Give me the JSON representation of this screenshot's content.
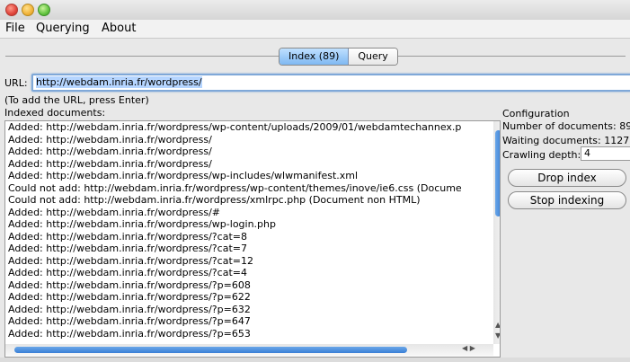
{
  "menu": [
    "File",
    "Querying",
    "About"
  ],
  "tabs": {
    "index": "Index (89)",
    "query": "Query"
  },
  "url": {
    "label": "URL:",
    "value": "http://webdam.inria.fr/wordpress/"
  },
  "hint": "(To add the URL, press Enter)",
  "indexed_label": "Indexed documents:",
  "log": [
    "Added: http://webdam.inria.fr/wordpress/wp-content/uploads/2009/01/webdamtechannex.p",
    "Added: http://webdam.inria.fr/wordpress/",
    "Added: http://webdam.inria.fr/wordpress/",
    "Added: http://webdam.inria.fr/wordpress/",
    "Added: http://webdam.inria.fr/wordpress/wp-includes/wlwmanifest.xml",
    "Could not add: http://webdam.inria.fr/wordpress/wp-content/themes/inove/ie6.css (Docume",
    "Could not add: http://webdam.inria.fr/wordpress/xmlrpc.php (Document non HTML)",
    "Added: http://webdam.inria.fr/wordpress/#",
    "Added: http://webdam.inria.fr/wordpress/wp-login.php",
    "Added: http://webdam.inria.fr/wordpress/?cat=8",
    "Added: http://webdam.inria.fr/wordpress/?cat=7",
    "Added: http://webdam.inria.fr/wordpress/?cat=12",
    "Added: http://webdam.inria.fr/wordpress/?cat=4",
    "Added: http://webdam.inria.fr/wordpress/?p=608",
    "Added: http://webdam.inria.fr/wordpress/?p=622",
    "Added: http://webdam.inria.fr/wordpress/?p=632",
    "Added: http://webdam.inria.fr/wordpress/?p=647",
    "Added: http://webdam.inria.fr/wordpress/?p=653"
  ],
  "config": {
    "title": "Configuration",
    "num_docs": "Number of documents: 89",
    "waiting_docs": "Waiting documents: 1127",
    "depth_label": "Crawling depth:",
    "depth_value": "4",
    "drop_btn": "Drop index",
    "stop_btn": "Stop indexing"
  },
  "colors": {
    "accent": "#3a7fd6",
    "tab_active": "#7fb8f2"
  }
}
